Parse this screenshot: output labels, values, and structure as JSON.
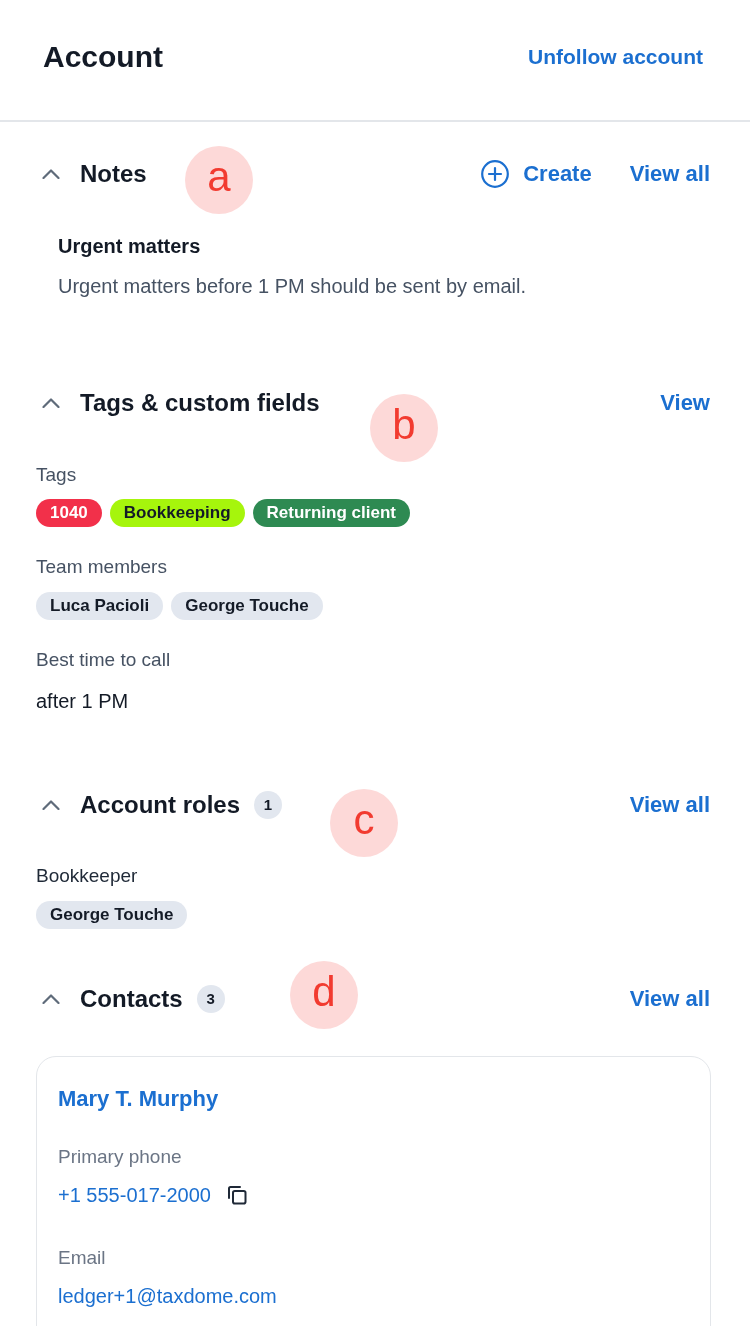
{
  "header": {
    "title": "Account",
    "action": "Unfollow account"
  },
  "sections": [
    {
      "kind": "notes",
      "title": "Notes",
      "expanded": true,
      "marker": "a",
      "actions": [
        {
          "kind": "create",
          "label": "Create"
        },
        {
          "kind": "link",
          "label": "View all"
        }
      ],
      "notes": [
        {
          "title": "Urgent matters",
          "body": "Urgent matters before 1 PM should be sent by email."
        }
      ]
    },
    {
      "kind": "fields",
      "title": "Tags & custom fields",
      "expanded": true,
      "marker": "b",
      "actions": [
        {
          "kind": "link",
          "label": "View"
        }
      ],
      "fields": [
        {
          "kind": "tags",
          "label": "Tags",
          "items": [
            {
              "label": "1040",
              "color": "#f2304a"
            },
            {
              "label": "Bookkeeping",
              "color": "#a6f50c"
            },
            {
              "label": "Returning client",
              "color": "#2e8a52"
            }
          ]
        },
        {
          "kind": "chips",
          "label": "Team members",
          "items": [
            "Luca Pacioli",
            "George Touche"
          ]
        },
        {
          "kind": "text",
          "label": "Best time to call",
          "value": "after 1 PM"
        }
      ]
    },
    {
      "kind": "roles",
      "title": "Account roles",
      "count": "1",
      "expanded": true,
      "marker": "c",
      "actions": [
        {
          "kind": "link",
          "label": "View all"
        }
      ],
      "roles": [
        {
          "role": "Bookkeeper",
          "members": [
            "George Touche"
          ]
        }
      ]
    },
    {
      "kind": "contacts",
      "title": "Contacts",
      "count": "3",
      "expanded": true,
      "marker": "d",
      "actions": [
        {
          "kind": "link",
          "label": "View all"
        }
      ],
      "contacts": [
        {
          "name": "Mary T. Murphy",
          "fields": [
            {
              "kind": "phone",
              "label": "Primary phone",
              "value": "+1 555-017-2000"
            },
            {
              "kind": "email",
              "label": "Email",
              "value": "ledger+1@taxdome.com"
            }
          ]
        }
      ]
    }
  ]
}
